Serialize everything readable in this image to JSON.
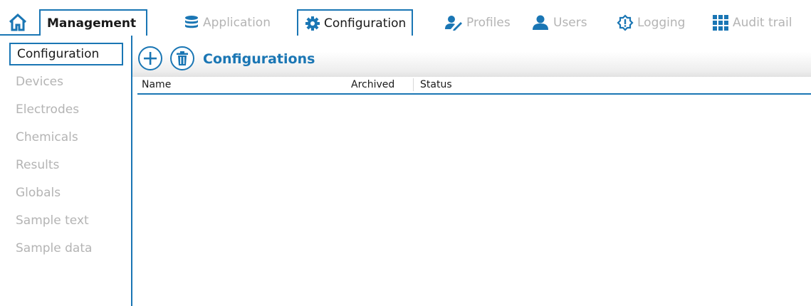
{
  "topbar": {
    "home_icon": "home-icon",
    "management_label": "Management",
    "tabs": [
      {
        "label": "Application",
        "icon": "database-icon"
      },
      {
        "label": "Configuration",
        "icon": "gear-icon"
      },
      {
        "label": "Profiles",
        "icon": "user-edit-icon"
      },
      {
        "label": "Users",
        "icon": "user-icon"
      },
      {
        "label": "Logging",
        "icon": "alert-gear-icon"
      },
      {
        "label": "Audit trail",
        "icon": "grid-icon"
      }
    ],
    "active_tab": "Configuration"
  },
  "sidebar": {
    "items": [
      {
        "label": "Configuration"
      },
      {
        "label": "Devices"
      },
      {
        "label": "Electrodes"
      },
      {
        "label": "Chemicals"
      },
      {
        "label": "Results"
      },
      {
        "label": "Globals"
      },
      {
        "label": "Sample text"
      },
      {
        "label": "Sample data"
      }
    ],
    "active_item": "Configuration"
  },
  "main": {
    "title": "Configurations",
    "add_icon": "plus-icon",
    "delete_icon": "trash-icon",
    "columns": [
      "Name",
      "Archived",
      "Status"
    ],
    "rows": []
  },
  "colors": {
    "accent": "#1a76b4",
    "inactive_text": "#b4b4b4",
    "text": "#1a1a1a"
  }
}
